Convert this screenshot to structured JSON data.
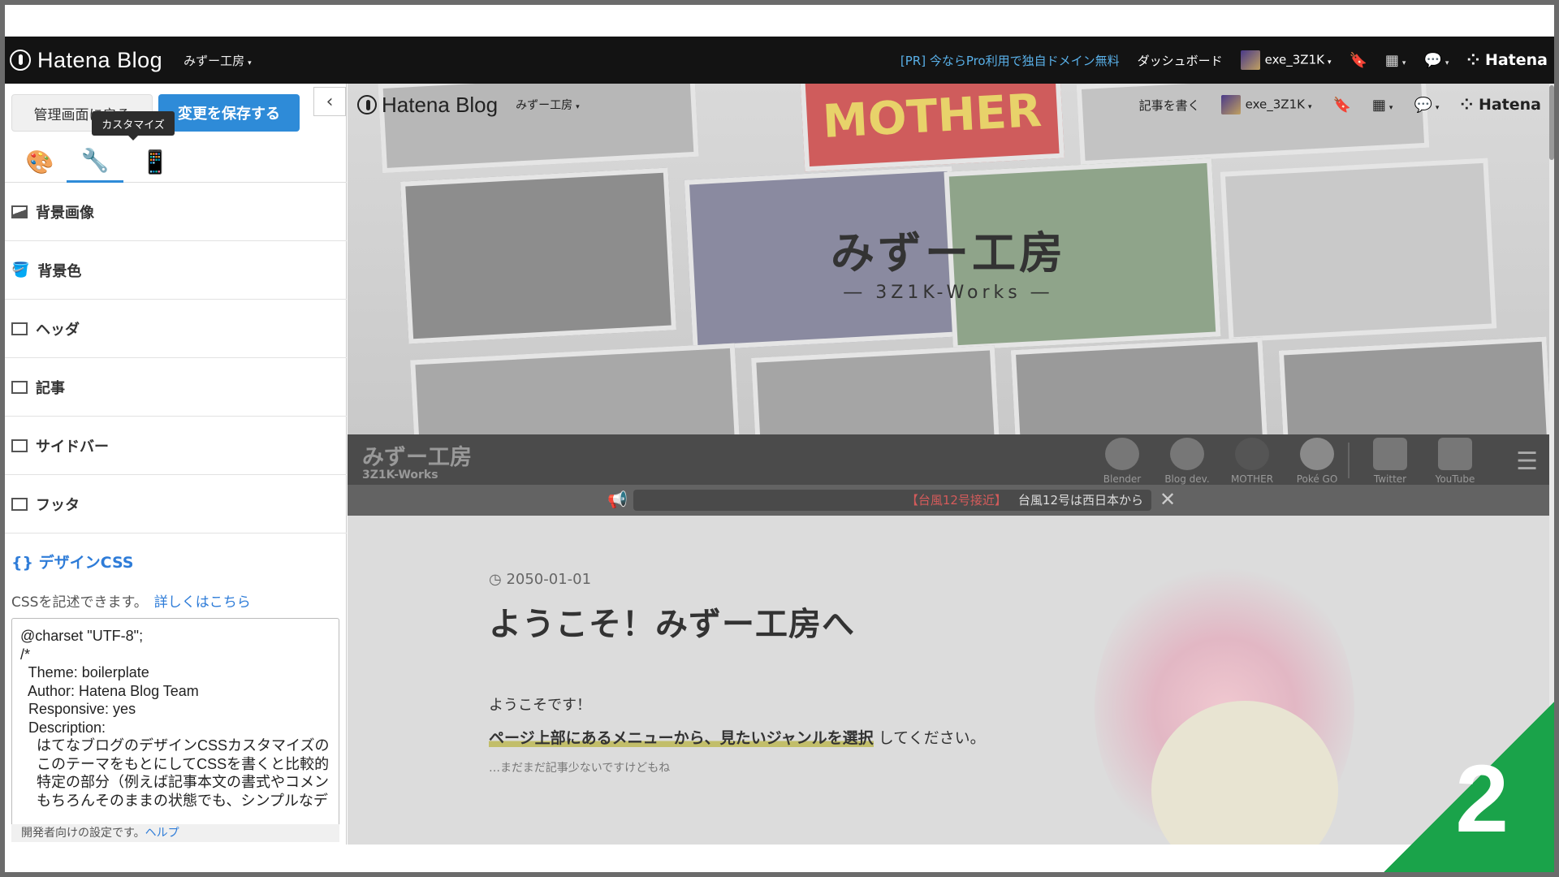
{
  "global_bar": {
    "logo": "Hatena Blog",
    "blog_name": "みずー工房",
    "pr": "[PR] 今ならPro利用で独自ドメイン無料",
    "dashboard": "ダッシュボード",
    "user": "exe_3Z1K",
    "hatena": "Hatena"
  },
  "sidebar": {
    "back_button": "管理画面に戻る",
    "save_button": "変更を保存する",
    "tooltip": "カスタマイズ",
    "menu_items": [
      "背景画像",
      "背景色",
      "ヘッダ",
      "記事",
      "サイドバー",
      "フッタ"
    ],
    "css_title": "{} デザインCSS",
    "css_desc": "CSSを記述できます。",
    "css_link": "詳しくはこちら",
    "css_code": "@charset \"UTF-8\";\n/*\n  Theme: boilerplate\n  Author: Hatena Blog Team\n  Responsive: yes\n  Description:\n    はてなブログのデザインCSSカスタマイズの\n    このテーマをもとにしてCSSを書くと比較的\n    特定の部分（例えば記事本文の書式やコメン\n    もちろんそのままの状態でも、シンプルなデ",
    "dev_note": "開発者向けの設定です。",
    "dev_help": "ヘルプ"
  },
  "preview": {
    "nav": {
      "logo": "Hatena Blog",
      "blog_name": "みずー工房",
      "write": "記事を書く",
      "user": "exe_3Z1K",
      "hatena": "Hatena"
    },
    "hero": {
      "title": "みずー工房",
      "subtitle": "― 3Z1K-Works ―",
      "tile_text": "MOTHER"
    },
    "bar": {
      "title": "みずー工房",
      "subtitle": "3Z1K-Works",
      "items": [
        "Blender",
        "Blog dev.",
        "MOTHER",
        "Poké GO",
        "Twitter",
        "YouTube"
      ]
    },
    "ticker": {
      "highlight": "【台風12号接近】",
      "text": "台風12号は西日本から"
    },
    "article": {
      "date": "2050-01-01",
      "title": "ようこそ！みずー工房へ",
      "p1": "ようこそです！",
      "p2_highlight": "ページ上部にあるメニューから、見たいジャンルを選択",
      "p2_rest": "してください。",
      "p3": "…まだまだ記事少ないですけどもね"
    }
  },
  "badge": "2",
  "colors": {
    "accent": "#2e8bd8",
    "badge": "#1aa34a",
    "topbar": "#131313"
  }
}
